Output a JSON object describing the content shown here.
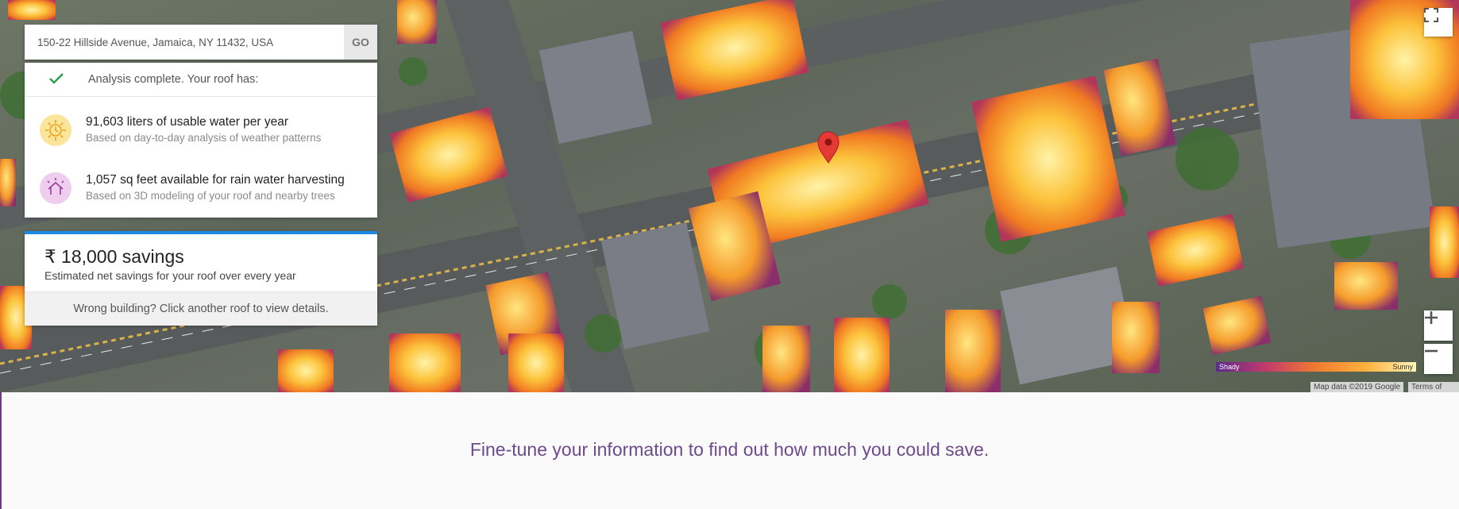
{
  "search": {
    "address_value": "150-22 Hillside Avenue, Jamaica, NY 11432, USA",
    "go_label": "GO"
  },
  "analysis": {
    "status_icon": "checkmark-icon",
    "status_text": "Analysis complete. Your roof has:",
    "stats": [
      {
        "icon": "sun-icon",
        "title": "91,603 liters of usable water per year",
        "subtitle": "Based on day-to-day analysis of weather patterns"
      },
      {
        "icon": "house-icon",
        "title": "1,057 sq feet available for rain water harvesting",
        "subtitle": "Based on 3D modeling of your roof and nearby trees"
      }
    ]
  },
  "savings": {
    "amount": "₹ 18,000 savings",
    "description": "Estimated net savings for your roof over every year",
    "wrong_building": "Wrong building? Click another roof to view details."
  },
  "map": {
    "legend": {
      "low_label": "Shady",
      "high_label": "Sunny"
    },
    "attribution": "Map data ©2019 Google",
    "terms": "Terms of Use",
    "marker_color": "#e53935"
  },
  "footer": {
    "tagline": "Fine-tune your information to find out how much you could save."
  },
  "colors": {
    "accent_blue": "#1e88e5",
    "check_green": "#2e9e4f",
    "tagline_purple": "#6d4a8b"
  }
}
